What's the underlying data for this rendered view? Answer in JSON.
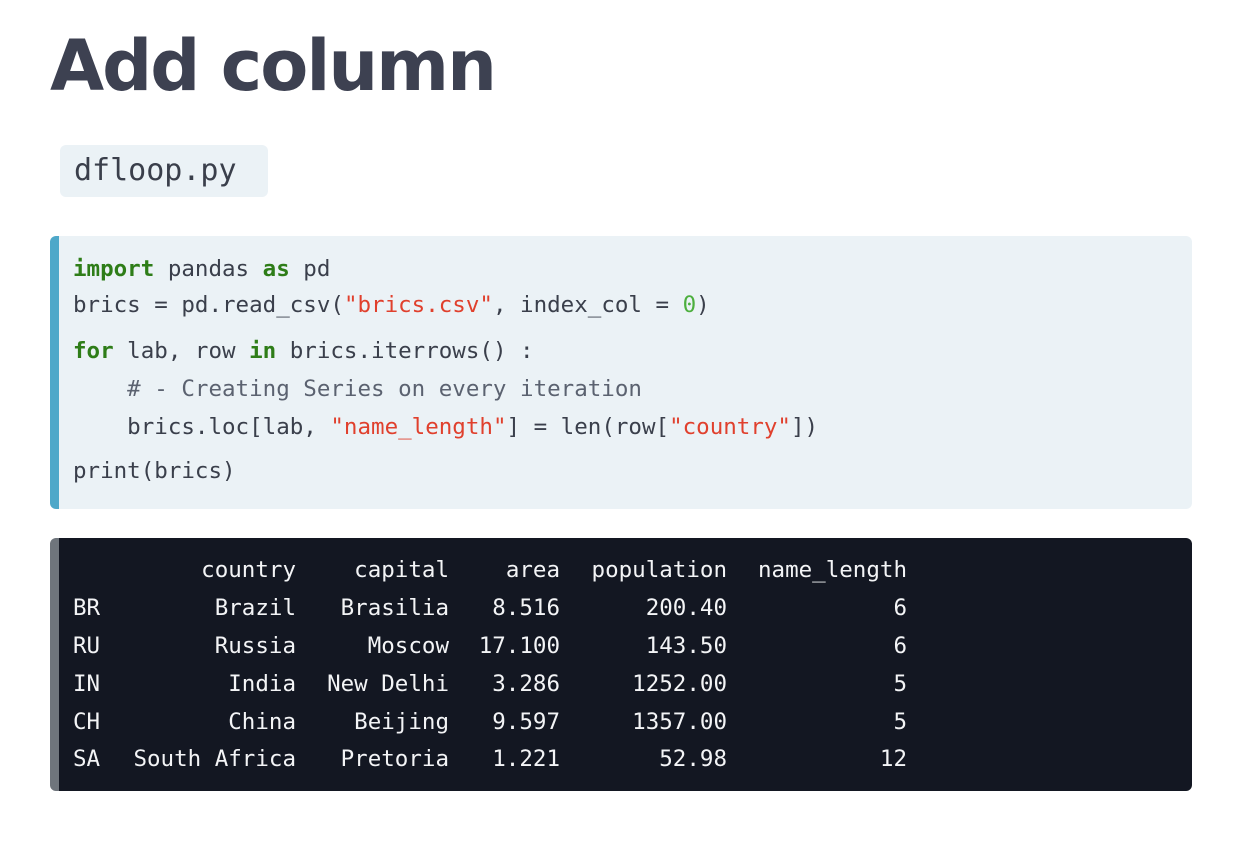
{
  "title": "Add column",
  "file_name": "dfloop.py",
  "code": {
    "line1": {
      "kw1": "import",
      "t1": " pandas ",
      "kw2": "as",
      "t2": " pd"
    },
    "line2": {
      "t1": "brics = pd.read_csv(",
      "str1": "\"brics.csv\"",
      "t2": ", index_col = ",
      "num1": "0",
      "t3": ")"
    },
    "line3": {
      "kw1": "for",
      "t1": " lab, row ",
      "kw2": "in",
      "t2": " brics.iterrows() :"
    },
    "line4": {
      "comment": "    # - Creating Series on every iteration"
    },
    "line5": {
      "t1": "    brics.loc[lab, ",
      "str1": "\"name_length\"",
      "t2": "] = len(row[",
      "str2": "\"country\"",
      "t3": "])"
    },
    "line6": {
      "t1": "print(brics)"
    }
  },
  "output": {
    "columns": [
      "country",
      "capital",
      "area",
      "population",
      "name_length"
    ],
    "rows": [
      {
        "index": "BR",
        "country": "Brazil",
        "capital": "Brasilia",
        "area": "8.516",
        "population": "200.40",
        "name_length": "6"
      },
      {
        "index": "RU",
        "country": "Russia",
        "capital": "Moscow",
        "area": "17.100",
        "population": "143.50",
        "name_length": "6"
      },
      {
        "index": "IN",
        "country": "India",
        "capital": "New Delhi",
        "area": "3.286",
        "population": "1252.00",
        "name_length": "5"
      },
      {
        "index": "CH",
        "country": "China",
        "capital": "Beijing",
        "area": "9.597",
        "population": "1357.00",
        "name_length": "5"
      },
      {
        "index": "SA",
        "country": "South Africa",
        "capital": "Pretoria",
        "area": "1.221",
        "population": "52.98",
        "name_length": "12"
      }
    ]
  },
  "colors": {
    "title": "#3d4151",
    "code_bg": "#ebf2f6",
    "code_accent": "#4ea8c9",
    "keyword": "#2e7d18",
    "string": "#e0402d",
    "number": "#4caf3e",
    "output_bg": "#131722",
    "output_accent": "#6f757c"
  }
}
